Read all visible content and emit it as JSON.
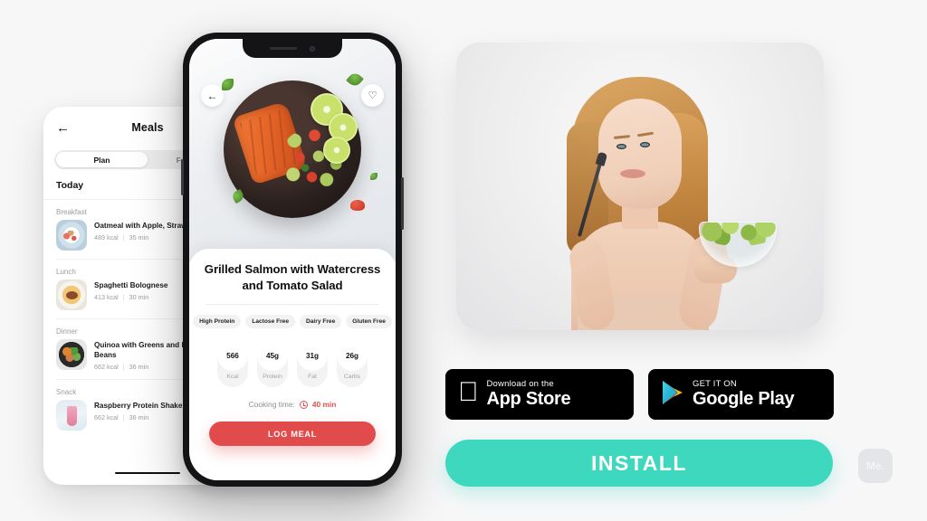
{
  "background_color": "#f7f7f8",
  "left_phone": {
    "header": {
      "back_icon": "back-arrow-icon",
      "title": "Meals"
    },
    "tabs": [
      {
        "label": "Plan",
        "active": true
      },
      {
        "label": "Favorites",
        "active": false
      }
    ],
    "day_label": "Today",
    "sections": [
      {
        "label": "Breakfast",
        "meals": [
          {
            "name": "Oatmeal with Apple, Strawberries",
            "calories": "489 kcal",
            "time": "35 min",
            "thumb": "oatmeal-thumbnail"
          }
        ]
      },
      {
        "label": "Lunch",
        "meals": [
          {
            "name": "Spaghetti Bolognese",
            "calories": "413 kcal",
            "time": "30 min",
            "thumb": "spaghetti-thumbnail"
          }
        ]
      },
      {
        "label": "Dinner",
        "meals": [
          {
            "name": "Quinoa with Greens and Edamame Beans",
            "calories": "662 kcal",
            "time": "36 min",
            "thumb": "quinoa-thumbnail"
          }
        ]
      },
      {
        "label": "Snack",
        "meals": [
          {
            "name": "Raspberry Protein Shake",
            "calories": "662 kcal",
            "time": "36 min",
            "thumb": "shake-thumbnail"
          }
        ]
      }
    ],
    "meta_separator": "|"
  },
  "main_phone": {
    "back_icon": "back-arrow-icon",
    "favorite_icon": "heart-outline-icon",
    "hero_image": "grilled-salmon-plate-photo",
    "dish_title": "Grilled Salmon with Watercress and Tomato Salad",
    "tags": [
      "High Protein",
      "Lactose Free",
      "Dairy Free",
      "Gluten Free"
    ],
    "nutrition": [
      {
        "value": "566",
        "label": "Kcal"
      },
      {
        "value": "45g",
        "label": "Protein"
      },
      {
        "value": "31g",
        "label": "Fat"
      },
      {
        "value": "26g",
        "label": "Carbs"
      }
    ],
    "cooking_time": {
      "label": "Cooking time:",
      "icon": "clock-icon",
      "value": "40 min"
    },
    "primary_button": "LOG MEAL",
    "primary_button_color": "#e24b4b"
  },
  "promo": {
    "photo_alt": "woman-holding-salad-bowl-photo",
    "app_store": {
      "small_text": "Download on the",
      "big_text": "App Store",
      "icon": "apple-logo-icon"
    },
    "google_play": {
      "small_text": "GET IT ON",
      "big_text": "Google Play",
      "icon": "google-play-icon"
    },
    "install_button": "INSTALL",
    "install_color": "#3ed8bf",
    "watermark": "Me."
  }
}
